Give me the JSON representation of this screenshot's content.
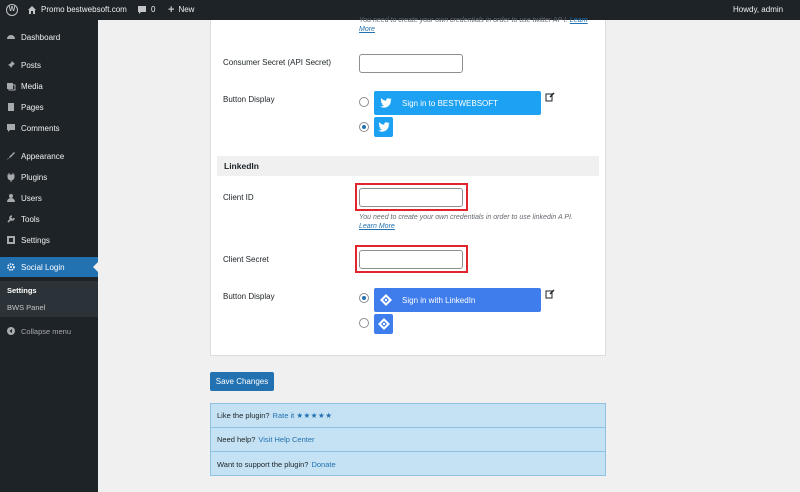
{
  "admin_bar": {
    "site_name": "Promo bestwebsoft.com",
    "comments_count": "0",
    "new_label": "New",
    "howdy": "Howdy, admin"
  },
  "sidebar": {
    "items": [
      {
        "label": "Dashboard",
        "icon": "dashboard-icon"
      },
      {
        "label": "Posts",
        "icon": "pin-icon"
      },
      {
        "label": "Media",
        "icon": "media-icon"
      },
      {
        "label": "Pages",
        "icon": "pages-icon"
      },
      {
        "label": "Comments",
        "icon": "comment-icon"
      },
      {
        "label": "Appearance",
        "icon": "brush-icon"
      },
      {
        "label": "Plugins",
        "icon": "plug-icon"
      },
      {
        "label": "Users",
        "icon": "user-icon"
      },
      {
        "label": "Tools",
        "icon": "wrench-icon"
      },
      {
        "label": "Settings",
        "icon": "settings-icon"
      },
      {
        "label": "Social Login",
        "icon": "gear-icon"
      }
    ],
    "submenu": [
      "Settings",
      "BWS Panel"
    ],
    "collapse_label": "Collapse menu"
  },
  "twitter": {
    "help_text": "You need to create your own credentials in order to use twitter AP I.",
    "help_link": "Learn More",
    "consumer_secret_label": "Consumer Secret (API Secret)",
    "consumer_secret_value": "",
    "button_display_label": "Button Display",
    "button_text": "Sign in to BESTWEBSOFT",
    "selected_option": "icon"
  },
  "linkedin": {
    "section_title": "LinkedIn",
    "client_id_label": "Client ID",
    "client_id_value": "",
    "help_text": "You need to create your own credentials in order to use linkedin A PI.",
    "help_link": "Learn More",
    "client_secret_label": "Client Secret",
    "client_secret_value": "",
    "button_display_label": "Button Display",
    "button_text": "Sign in with LinkedIn",
    "selected_option": "full"
  },
  "save_button": "Save Changes",
  "info": {
    "rate_text": "Like the plugin?",
    "rate_link": "Rate it",
    "stars": "★★★★★",
    "help_text": "Need help?",
    "help_link": "Visit Help Center",
    "support_text": "Want to support the plugin?",
    "support_link": "Donate"
  },
  "colors": {
    "accent": "#2271b1",
    "twitter": "#1da1f2",
    "linkedin": "#3f7cec",
    "highlight": "#e0262c"
  }
}
